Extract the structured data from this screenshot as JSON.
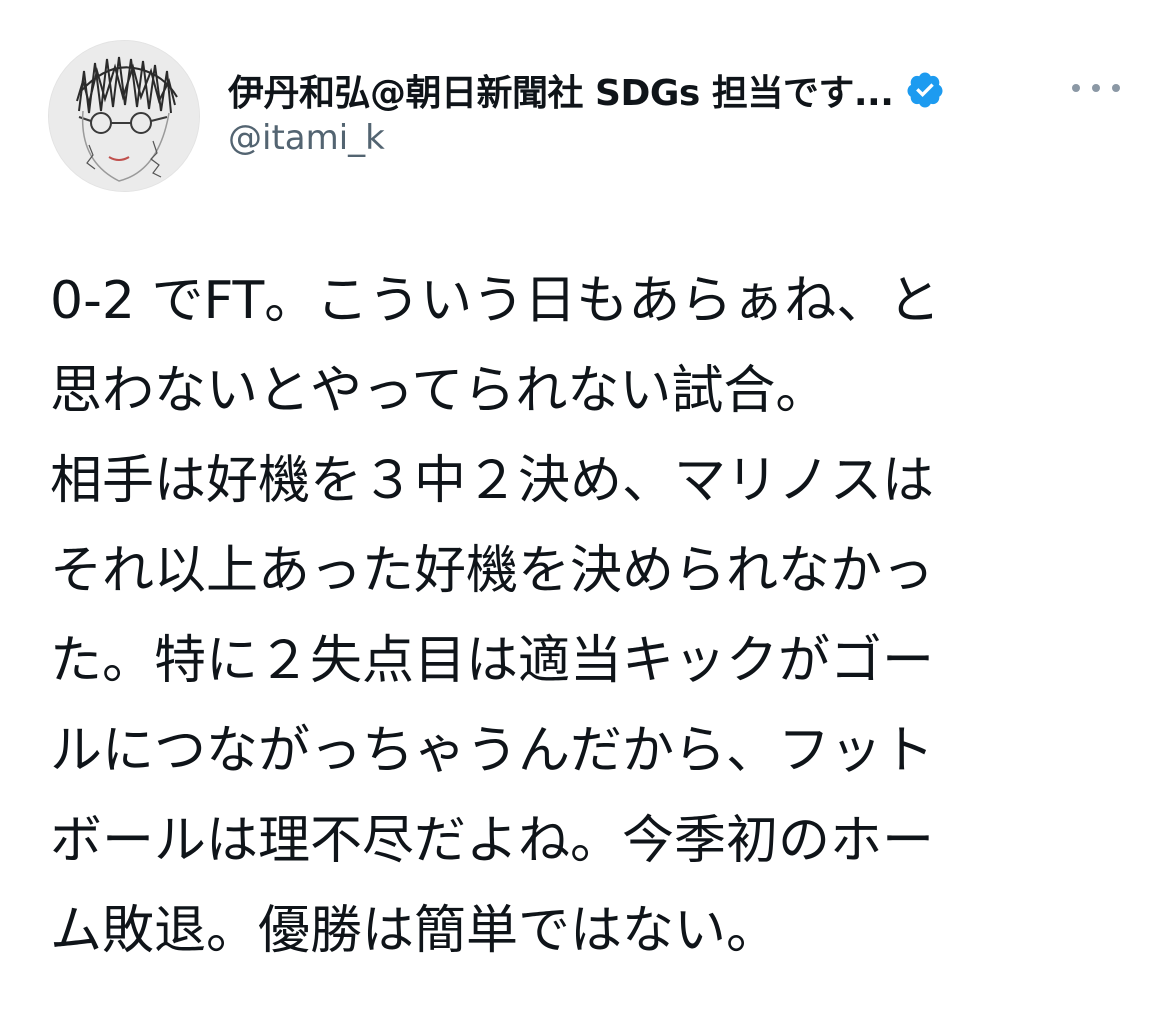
{
  "author": {
    "display_name": "伊丹和弘@朝日新聞社 SDGs 担当です...",
    "handle": "@itami_k",
    "verified": true,
    "avatar_icon": "hand-drawn-portrait-avatar",
    "verified_icon": "verified-badge-icon",
    "verified_color": "#1d9bf0"
  },
  "menu": {
    "icon": "more-options-icon"
  },
  "tweet": {
    "lines": [
      "0-2 でFT。こういう日もあらぁね、と",
      "思わないとやってられない試合。",
      "相手は好機を３中２決め、マリノスは",
      "それ以上あった好機を決められなかっ",
      "た。特に２失点目は適当キックがゴー",
      "ルにつながっちゃうんだから、フット",
      "ボールは理不尽だよね。今季初のホー",
      "ム敗退。優勝は簡単ではない。"
    ]
  }
}
